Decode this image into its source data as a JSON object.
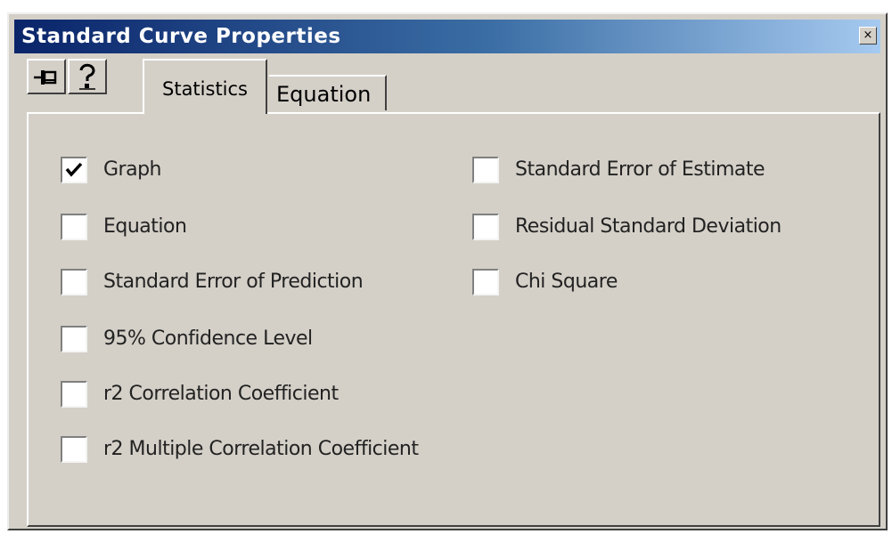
{
  "window": {
    "title": "Standard Curve Properties",
    "close_glyph": "×"
  },
  "toolbar": {
    "pin_icon": "pin-icon",
    "help_icon": "help-icon"
  },
  "tabs": [
    {
      "label": "Statistics",
      "active": true
    },
    {
      "label": "Equation",
      "active": false
    }
  ],
  "options": {
    "left": [
      {
        "label": "Graph",
        "checked": true
      },
      {
        "label": "Equation",
        "checked": false
      },
      {
        "label": "Standard Error of Prediction",
        "checked": false
      },
      {
        "label": "95% Confidence Level",
        "checked": false
      },
      {
        "label": "r2 Correlation Coefficient",
        "checked": false
      },
      {
        "label": "r2 Multiple Correlation Coefficient",
        "checked": false
      }
    ],
    "right": [
      {
        "label": "Standard Error of Estimate",
        "checked": false
      },
      {
        "label": "Residual Standard Deviation",
        "checked": false
      },
      {
        "label": "Chi Square",
        "checked": false
      }
    ]
  },
  "colors": {
    "title_gradient_start": "#0a246a",
    "title_gradient_end": "#a6caf0",
    "face": "#d4d0c8"
  }
}
